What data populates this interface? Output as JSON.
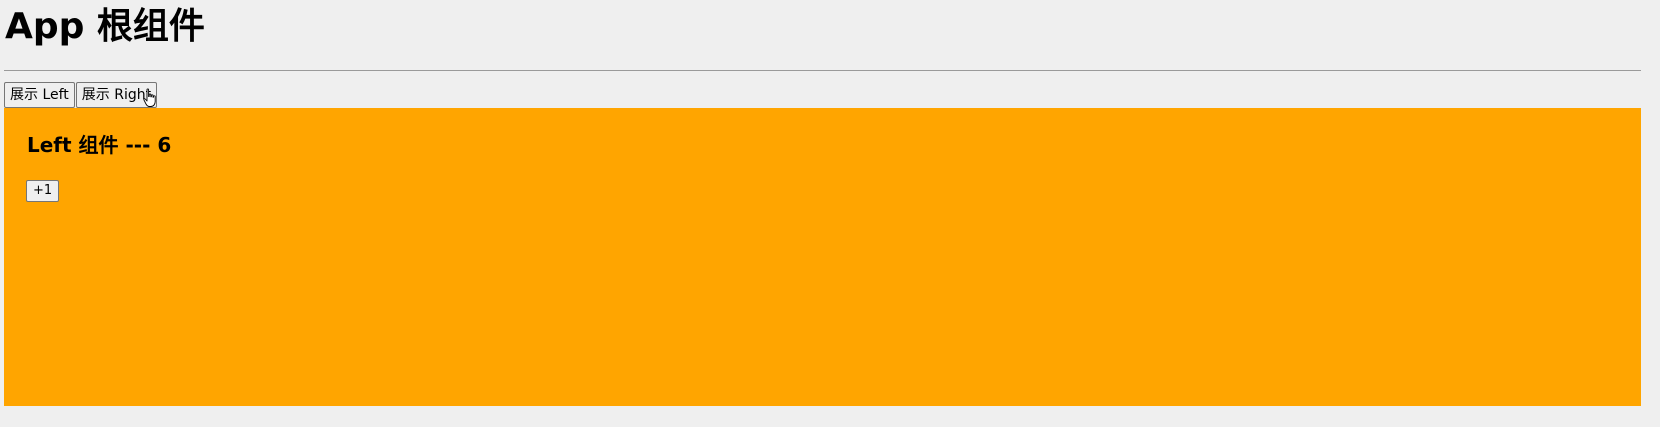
{
  "app": {
    "title": "App 根组件"
  },
  "tabs": {
    "show_left_label": "展示 Left",
    "show_right_label": "展示 Right"
  },
  "left_component": {
    "heading": "Left 组件 --- 6",
    "increment_label": "+1",
    "background_color": "#ffa500"
  },
  "cursor": {
    "icon": "hand-pointer-icon"
  }
}
